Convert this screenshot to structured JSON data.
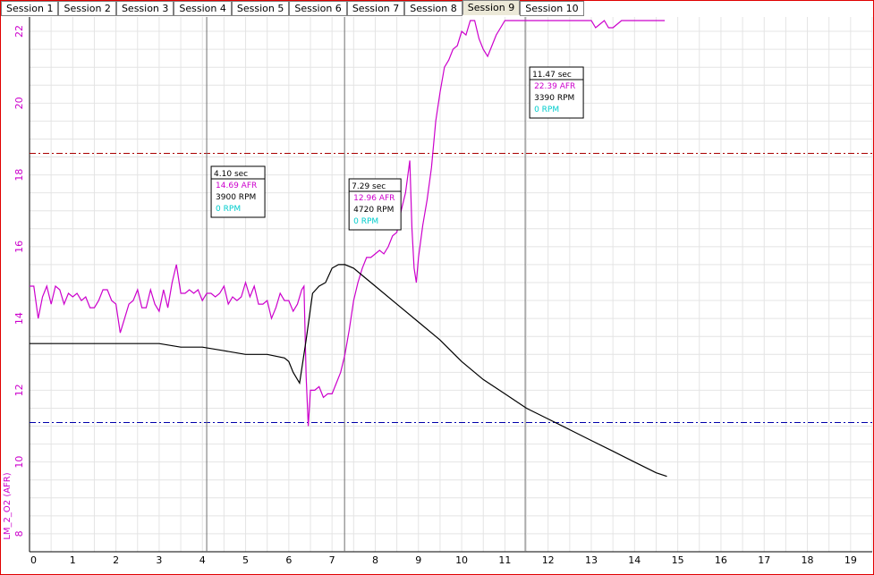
{
  "tabs": [
    "Session 1",
    "Session 2",
    "Session 3",
    "Session 4",
    "Session 5",
    "Session 6",
    "Session 7",
    "Session 8",
    "Session 9",
    "Session 10"
  ],
  "active_tab": 8,
  "colors": {
    "afr": "#cc00cc",
    "rpm": "#000000",
    "upper_ref": "#aa0000",
    "lower_ref": "#0000aa",
    "speed": "#00cccc",
    "grid": "#e4e4e4",
    "cursor": "#707070",
    "border": "#e00000"
  },
  "chart_data": {
    "type": "line",
    "xlim": [
      0,
      19.5
    ],
    "ylim": [
      7.5,
      22.4
    ],
    "xticks": [
      0,
      1,
      2,
      3,
      4,
      5,
      6,
      7,
      8,
      9,
      10,
      11,
      12,
      13,
      14,
      15,
      16,
      17,
      18,
      19
    ],
    "yticks": [
      8,
      10,
      12,
      14,
      16,
      18,
      20,
      22
    ],
    "ylabel": "LM_2_O2 (AFR)",
    "grid": true,
    "reference_lines": [
      {
        "y": 18.6,
        "color": "#aa0000"
      },
      {
        "y": 11.1,
        "color": "#0000aa"
      }
    ],
    "series": [
      {
        "name": "AFR",
        "color": "#cc00cc",
        "points": [
          [
            0.0,
            14.9
          ],
          [
            0.1,
            14.9
          ],
          [
            0.2,
            14.0
          ],
          [
            0.3,
            14.6
          ],
          [
            0.4,
            14.9
          ],
          [
            0.5,
            14.4
          ],
          [
            0.6,
            14.9
          ],
          [
            0.7,
            14.8
          ],
          [
            0.8,
            14.4
          ],
          [
            0.9,
            14.7
          ],
          [
            1.0,
            14.6
          ],
          [
            1.1,
            14.7
          ],
          [
            1.2,
            14.5
          ],
          [
            1.3,
            14.6
          ],
          [
            1.4,
            14.3
          ],
          [
            1.5,
            14.3
          ],
          [
            1.6,
            14.5
          ],
          [
            1.7,
            14.8
          ],
          [
            1.8,
            14.8
          ],
          [
            1.9,
            14.5
          ],
          [
            2.0,
            14.4
          ],
          [
            2.1,
            13.6
          ],
          [
            2.2,
            14.0
          ],
          [
            2.3,
            14.4
          ],
          [
            2.4,
            14.5
          ],
          [
            2.5,
            14.8
          ],
          [
            2.6,
            14.3
          ],
          [
            2.7,
            14.3
          ],
          [
            2.8,
            14.8
          ],
          [
            2.9,
            14.4
          ],
          [
            3.0,
            14.2
          ],
          [
            3.1,
            14.8
          ],
          [
            3.2,
            14.3
          ],
          [
            3.3,
            15.0
          ],
          [
            3.4,
            15.5
          ],
          [
            3.5,
            14.7
          ],
          [
            3.6,
            14.7
          ],
          [
            3.7,
            14.8
          ],
          [
            3.8,
            14.7
          ],
          [
            3.9,
            14.8
          ],
          [
            4.0,
            14.5
          ],
          [
            4.1,
            14.7
          ],
          [
            4.2,
            14.7
          ],
          [
            4.3,
            14.6
          ],
          [
            4.4,
            14.7
          ],
          [
            4.5,
            14.9
          ],
          [
            4.6,
            14.4
          ],
          [
            4.7,
            14.6
          ],
          [
            4.8,
            14.5
          ],
          [
            4.9,
            14.6
          ],
          [
            5.0,
            15.0
          ],
          [
            5.1,
            14.6
          ],
          [
            5.2,
            14.9
          ],
          [
            5.3,
            14.4
          ],
          [
            5.4,
            14.4
          ],
          [
            5.5,
            14.5
          ],
          [
            5.6,
            14.0
          ],
          [
            5.7,
            14.3
          ],
          [
            5.8,
            14.7
          ],
          [
            5.9,
            14.5
          ],
          [
            6.0,
            14.5
          ],
          [
            6.1,
            14.2
          ],
          [
            6.2,
            14.4
          ],
          [
            6.3,
            14.8
          ],
          [
            6.35,
            14.9
          ],
          [
            6.4,
            12.4
          ],
          [
            6.45,
            11.0
          ],
          [
            6.5,
            12.0
          ],
          [
            6.6,
            12.0
          ],
          [
            6.7,
            12.1
          ],
          [
            6.8,
            11.8
          ],
          [
            6.9,
            11.9
          ],
          [
            7.0,
            11.9
          ],
          [
            7.1,
            12.2
          ],
          [
            7.2,
            12.5
          ],
          [
            7.3,
            13.0
          ],
          [
            7.4,
            13.7
          ],
          [
            7.5,
            14.5
          ],
          [
            7.6,
            15.0
          ],
          [
            7.7,
            15.4
          ],
          [
            7.8,
            15.7
          ],
          [
            7.9,
            15.7
          ],
          [
            8.0,
            15.8
          ],
          [
            8.1,
            15.9
          ],
          [
            8.2,
            15.8
          ],
          [
            8.3,
            16.0
          ],
          [
            8.4,
            16.3
          ],
          [
            8.5,
            16.4
          ],
          [
            8.6,
            17.0
          ],
          [
            8.7,
            17.5
          ],
          [
            8.8,
            18.4
          ],
          [
            8.85,
            16.5
          ],
          [
            8.9,
            15.4
          ],
          [
            8.95,
            15.0
          ],
          [
            9.0,
            15.7
          ],
          [
            9.1,
            16.6
          ],
          [
            9.2,
            17.3
          ],
          [
            9.3,
            18.2
          ],
          [
            9.4,
            19.5
          ],
          [
            9.5,
            20.3
          ],
          [
            9.6,
            21.0
          ],
          [
            9.7,
            21.2
          ],
          [
            9.8,
            21.5
          ],
          [
            9.9,
            21.6
          ],
          [
            10.0,
            22.0
          ],
          [
            10.1,
            21.9
          ],
          [
            10.2,
            22.3
          ],
          [
            10.3,
            22.3
          ],
          [
            10.4,
            21.8
          ],
          [
            10.5,
            21.5
          ],
          [
            10.6,
            21.3
          ],
          [
            10.7,
            21.6
          ],
          [
            10.8,
            21.9
          ],
          [
            10.9,
            22.1
          ],
          [
            11.0,
            22.3
          ],
          [
            11.1,
            22.3
          ],
          [
            11.2,
            22.3
          ],
          [
            11.3,
            22.3
          ],
          [
            11.4,
            22.3
          ],
          [
            11.5,
            22.3
          ],
          [
            12.0,
            22.3
          ],
          [
            12.5,
            22.3
          ],
          [
            13.0,
            22.3
          ],
          [
            13.1,
            22.1
          ],
          [
            13.2,
            22.2
          ],
          [
            13.3,
            22.3
          ],
          [
            13.4,
            22.1
          ],
          [
            13.5,
            22.1
          ],
          [
            13.6,
            22.2
          ],
          [
            13.7,
            22.3
          ],
          [
            14.0,
            22.3
          ],
          [
            14.5,
            22.3
          ],
          [
            14.7,
            22.3
          ]
        ]
      },
      {
        "name": "RPM",
        "color": "#000000",
        "points": [
          [
            0.0,
            13.3
          ],
          [
            1.0,
            13.3
          ],
          [
            2.0,
            13.3
          ],
          [
            3.0,
            13.3
          ],
          [
            3.5,
            13.2
          ],
          [
            4.0,
            13.2
          ],
          [
            4.5,
            13.1
          ],
          [
            5.0,
            13.0
          ],
          [
            5.5,
            13.0
          ],
          [
            5.9,
            12.9
          ],
          [
            6.0,
            12.8
          ],
          [
            6.1,
            12.5
          ],
          [
            6.25,
            12.2
          ],
          [
            6.4,
            13.4
          ],
          [
            6.55,
            14.7
          ],
          [
            6.7,
            14.9
          ],
          [
            6.85,
            15.0
          ],
          [
            7.0,
            15.4
          ],
          [
            7.15,
            15.5
          ],
          [
            7.3,
            15.5
          ],
          [
            7.5,
            15.4
          ],
          [
            7.7,
            15.2
          ],
          [
            8.0,
            14.9
          ],
          [
            8.5,
            14.4
          ],
          [
            9.0,
            13.9
          ],
          [
            9.5,
            13.4
          ],
          [
            10.0,
            12.8
          ],
          [
            10.5,
            12.3
          ],
          [
            11.0,
            11.9
          ],
          [
            11.5,
            11.5
          ],
          [
            12.0,
            11.2
          ],
          [
            12.5,
            10.9
          ],
          [
            13.0,
            10.6
          ],
          [
            13.5,
            10.3
          ],
          [
            14.0,
            10.0
          ],
          [
            14.5,
            9.7
          ],
          [
            14.75,
            9.6
          ]
        ]
      }
    ],
    "cursors": [
      {
        "x": 4.1,
        "time": "4.10 sec",
        "afr": "14.69 AFR",
        "rpm": "3900 RPM",
        "speed": "0 RPM"
      },
      {
        "x": 7.29,
        "time": "7.29 sec",
        "afr": "12.96 AFR",
        "rpm": "4720 RPM",
        "speed": "0 RPM"
      },
      {
        "x": 11.47,
        "time": "11.47 sec",
        "afr": "22.39 AFR",
        "rpm": "3390 RPM",
        "speed": "0 RPM"
      }
    ]
  }
}
